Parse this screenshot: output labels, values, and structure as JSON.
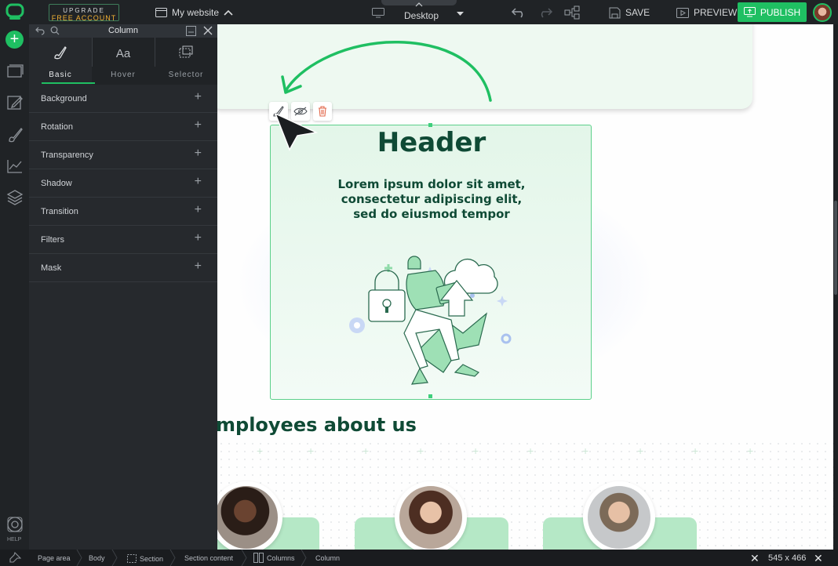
{
  "topbar": {
    "upgrade_line1": "UPGRADE",
    "upgrade_line2": "FREE ACCOUNT",
    "site_name": "My website",
    "device": "Desktop",
    "save": "SAVE",
    "preview": "PREVIEW",
    "publish": "PUBLISH"
  },
  "rail": {
    "help": "HELP"
  },
  "panel": {
    "title": "Column",
    "tabs": [
      {
        "label": "Basic",
        "icon": "brush-icon"
      },
      {
        "label": "Hover",
        "icon": "text-style-icon"
      },
      {
        "label": "Selector",
        "icon": "selector-icon"
      }
    ],
    "icon_tab_labels": [
      "Aa"
    ],
    "rows": [
      "Background",
      "Rotation",
      "Transparency",
      "Shadow",
      "Transition",
      "Filters",
      "Mask"
    ]
  },
  "canvas": {
    "column_header": "Header",
    "column_text": "Lorem ipsum dolor sit amet, consectetur adipiscing elit, sed do eiusmod tempor",
    "section_title": "mployees about us"
  },
  "bottombar": {
    "crumbs": [
      "Page area",
      "Body",
      "Section",
      "Section content",
      "Columns",
      "Column"
    ],
    "dimensions": "545 x 466"
  },
  "colors": {
    "accent": "#1fbf62",
    "dark_text": "#0f4a35",
    "upgrade_gold": "#f2b134"
  }
}
